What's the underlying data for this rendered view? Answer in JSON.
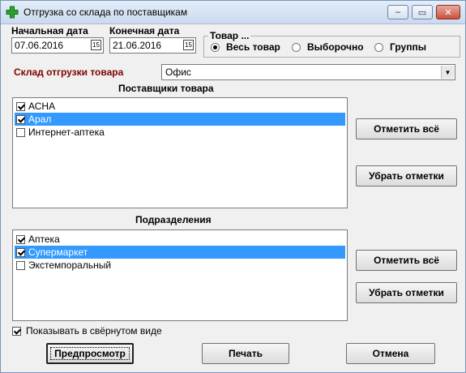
{
  "window": {
    "title": "Отгрузка со склада по поставщикам",
    "minimize": "–",
    "maximize": "▭",
    "close": "✕"
  },
  "dates": {
    "start_label": "Начальная дата",
    "start_value": "07.06.2016",
    "end_label": "Конечная дата",
    "end_value": "21.06.2016",
    "calendar_glyph": "15"
  },
  "goods": {
    "title": "Товар ...",
    "options": [
      "Весь товар",
      "Выборочно",
      "Группы"
    ],
    "selected": "Весь товар"
  },
  "warehouse": {
    "label": "Склад отгрузки товара",
    "value": "Офис",
    "label_color": "#800000"
  },
  "suppliers": {
    "heading": "Поставщики товара",
    "items": [
      {
        "label": "АСНА",
        "checked": true,
        "selected": false
      },
      {
        "label": "Арал",
        "checked": true,
        "selected": true
      },
      {
        "label": "Интернет-аптека",
        "checked": false,
        "selected": false
      }
    ],
    "check_all": "Отметить всё",
    "uncheck_all": "Убрать отметки"
  },
  "divisions": {
    "heading": "Подразделения",
    "items": [
      {
        "label": "Аптека",
        "checked": true,
        "selected": false
      },
      {
        "label": "Супермаркет",
        "checked": true,
        "selected": true
      },
      {
        "label": "Экстемпоральный",
        "checked": false,
        "selected": false
      }
    ],
    "check_all": "Отметить всё",
    "uncheck_all": "Убрать отметки"
  },
  "collapsed": {
    "label": "Показывать в свёрнутом виде",
    "checked": true
  },
  "footer": {
    "preview": "Предпросмотр",
    "print": "Печать",
    "cancel": "Отмена"
  },
  "colors": {
    "selection": "#3399ff",
    "window_bg": "#f0f0f0"
  }
}
